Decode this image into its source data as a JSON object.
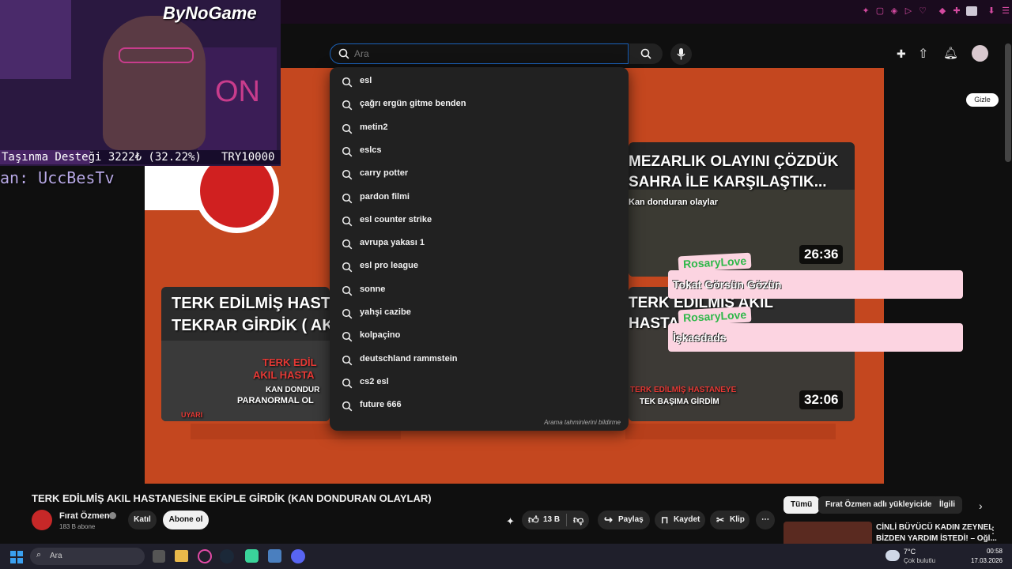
{
  "overlay": {
    "brand": "ByNoGame",
    "donation_text": "Taşınma Desteği 3222₺ (32.22%)",
    "donation_goal": "TRY10000",
    "donation_progress": 0.3222,
    "last_follower": "an: UccBesTv",
    "neon_sign": "ON"
  },
  "search": {
    "placeholder": "Ara",
    "footer": "Arama tahminlerini bildirme",
    "suggestions": [
      "esl",
      "çağrı ergün gitme benden",
      "metin2",
      "eslcs",
      "carry potter",
      "pardon filmi",
      "esl counter strike",
      "avrupa yakası 1",
      "esl pro league",
      "sonne",
      "yahşi cazibe",
      "kolpaçino",
      "deutschland rammstein",
      "cs2 esl",
      "future 666"
    ]
  },
  "hide_button": "Gizle",
  "thumbnails": {
    "left_bottom": {
      "title_line1": "TERK EDİLMİŞ HAST",
      "title_line2": "TEKRAR GİRDİK ( AK",
      "sub1": "TERK EDİL",
      "sub2": "AKIL HASTA",
      "sub3": "KAN DONDUR",
      "sub4": "PARANORMAL OL",
      "warn": "UYARI"
    },
    "right_top": {
      "title_line1": "MEZARLIK OLAYINI ÇÖZDÜK",
      "title_line2": "SAHRA İLE KARŞILAŞTIK...",
      "subtitle": "Kan donduran olaylar",
      "duration": "26:36"
    },
    "right_bottom": {
      "title_line1": "TERK EDİLMİŞ AKIL",
      "title_line2": "HASTA",
      "banner1": "TERK EDİLMİŞ HASTANEYE",
      "banner2": "TEK BAŞIMA GİRDİM",
      "duration": "32:06"
    }
  },
  "chat": [
    {
      "user": "RosaryLove",
      "message": "Tokat Görsün Gözün"
    },
    {
      "user": "RosaryLove",
      "message": "İşkasdads"
    }
  ],
  "video": {
    "title": "TERK EDİLMİŞ AKIL HASTANESİNE EKİPLE GİRDİK (KAN DONDURAN OLAYLAR)",
    "channel": "Fırat Özmen",
    "subscribers": "183 B abone",
    "join": "Katıl",
    "subscribe": "Abone ol",
    "likes": "13 B",
    "share": "Paylaş",
    "save": "Kaydet",
    "clip": "Klip"
  },
  "related": {
    "chips": [
      "Tümü",
      "Fırat Özmen adlı yükleyiciden",
      "İlgili"
    ],
    "item_title_line1": "CİNLİ BÜYÜCÜ KADIN ZEYNEL",
    "item_title_line2": "BİZDEN YARDIM İSTEDİ! – Oğl..."
  },
  "taskbar": {
    "search_placeholder": "Ara",
    "weather_temp": "7°C",
    "weather_desc": "Çok bulutlu",
    "time": "00:58",
    "date": "17.03.2026"
  },
  "colors": {
    "accent": "#c4471f",
    "search_border": "#1c62b9",
    "chat_bg": "#fcd4e1",
    "chat_name": "#2fb84a"
  }
}
